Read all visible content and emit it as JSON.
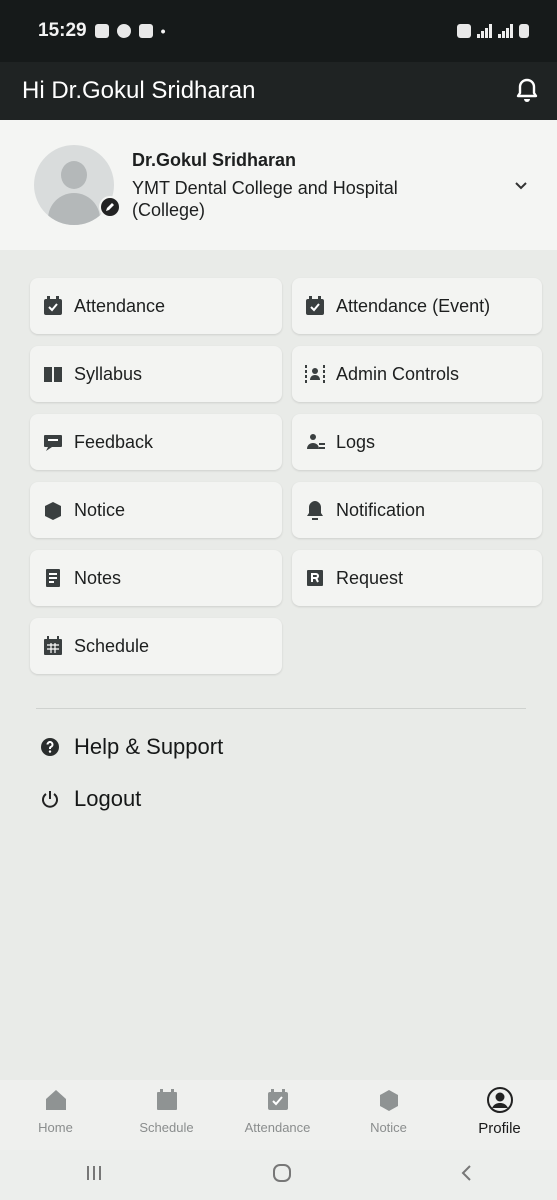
{
  "status_bar": {
    "time": "15:29"
  },
  "app_bar": {
    "title": "Hi Dr.Gokul Sridharan"
  },
  "profile": {
    "name": "Dr.Gokul Sridharan",
    "college": "YMT Dental College and Hospital (College)"
  },
  "menu": {
    "left": [
      {
        "label": "Attendance",
        "icon": "attendance-icon"
      },
      {
        "label": "Syllabus",
        "icon": "book-icon"
      },
      {
        "label": "Feedback",
        "icon": "feedback-icon"
      },
      {
        "label": "Notice",
        "icon": "notice-icon"
      },
      {
        "label": "Notes",
        "icon": "notes-icon"
      },
      {
        "label": "Schedule",
        "icon": "calendar-icon"
      }
    ],
    "right": [
      {
        "label": "Attendance (Event)",
        "icon": "attendance-icon"
      },
      {
        "label": "Admin Controls",
        "icon": "admin-icon"
      },
      {
        "label": "Logs",
        "icon": "logs-icon"
      },
      {
        "label": "Notification",
        "icon": "bell-icon"
      },
      {
        "label": "Request",
        "icon": "request-icon"
      }
    ]
  },
  "links": {
    "help": "Help & Support",
    "logout": "Logout"
  },
  "bottom_nav": [
    {
      "label": "Home",
      "icon": "home-icon",
      "active": false
    },
    {
      "label": "Schedule",
      "icon": "calendar-icon",
      "active": false
    },
    {
      "label": "Attendance",
      "icon": "attendance-icon",
      "active": false
    },
    {
      "label": "Notice",
      "icon": "notice-icon",
      "active": false
    },
    {
      "label": "Profile",
      "icon": "profile-icon",
      "active": true
    }
  ],
  "colors": {
    "header": "#1f2323",
    "background": "#e9ebe8",
    "tile": "#f3f4f2",
    "icon": "#3a3f40"
  }
}
